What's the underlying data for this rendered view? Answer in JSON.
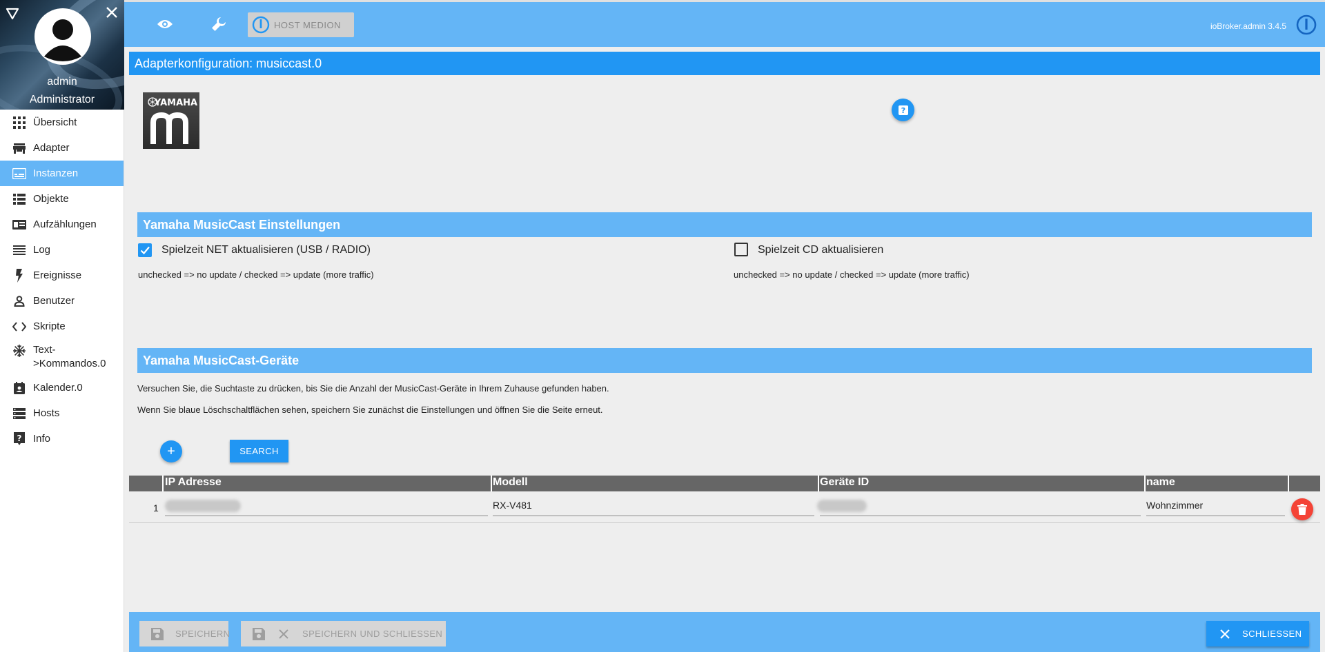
{
  "sidebar": {
    "user_name": "admin",
    "user_role": "Administrator",
    "items": [
      {
        "label": "Übersicht",
        "icon": "apps-grid-icon"
      },
      {
        "label": "Adapter",
        "icon": "store-icon"
      },
      {
        "label": "Instanzen",
        "icon": "instances-icon",
        "active": true
      },
      {
        "label": "Objekte",
        "icon": "list-icon"
      },
      {
        "label": "Aufzählungen",
        "icon": "enum-card-icon"
      },
      {
        "label": "Log",
        "icon": "log-lines-icon"
      },
      {
        "label": "Ereignisse",
        "icon": "lightning-icon"
      },
      {
        "label": "Benutzer",
        "icon": "person-icon"
      },
      {
        "label": "Skripte",
        "icon": "code-icon"
      },
      {
        "label": "Text-\n>Kommandos.0",
        "icon": "snowflake-icon"
      },
      {
        "label": "Kalender.0",
        "icon": "calendar-icon"
      },
      {
        "label": "Hosts",
        "icon": "hosts-icon"
      },
      {
        "label": "Info",
        "icon": "help-box-icon"
      }
    ]
  },
  "topbar": {
    "host_label": "HOST MEDION",
    "version": "ioBroker.admin 3.4.5"
  },
  "page": {
    "title": "Adapterkonfiguration: musiccast.0",
    "logo_text": "YAMAHA"
  },
  "settings": {
    "heading": "Yamaha MusicCast Einstellungen",
    "net_label": "Spielzeit NET aktualisieren (USB / RADIO)",
    "net_checked": true,
    "net_hint": "unchecked => no update / checked => update (more traffic)",
    "cd_label": "Spielzeit CD aktualisieren",
    "cd_checked": false,
    "cd_hint": "unchecked => no update / checked => update (more traffic)"
  },
  "devices": {
    "heading": "Yamaha MusicCast-Geräte",
    "info1": "Versuchen Sie, die Suchtaste zu drücken, bis Sie die Anzahl der MusicCast-Geräte in Ihrem Zuhause gefunden haben.",
    "info2": "Wenn Sie blaue Löschschaltflächen sehen, speichern Sie zunächst die Einstellungen und öffnen Sie die Seite erneut.",
    "add_label": "+",
    "search_label": "SEARCH",
    "columns": [
      "IP Adresse",
      "Modell",
      "Geräte ID",
      "name"
    ],
    "rows": [
      {
        "index": "1",
        "ip": "",
        "model": "RX-V481",
        "device_id": "",
        "name": "Wohnzimmer"
      }
    ]
  },
  "bottombar": {
    "save_label": "SPEICHERN",
    "save_close_label": "SPEICHERN UND SCHLIESSEN",
    "close_label": "SCHLIESSEN"
  },
  "colors": {
    "primary": "#2196f3",
    "light_primary": "#64b5f6",
    "danger": "#f44336",
    "table_header": "#666666"
  }
}
